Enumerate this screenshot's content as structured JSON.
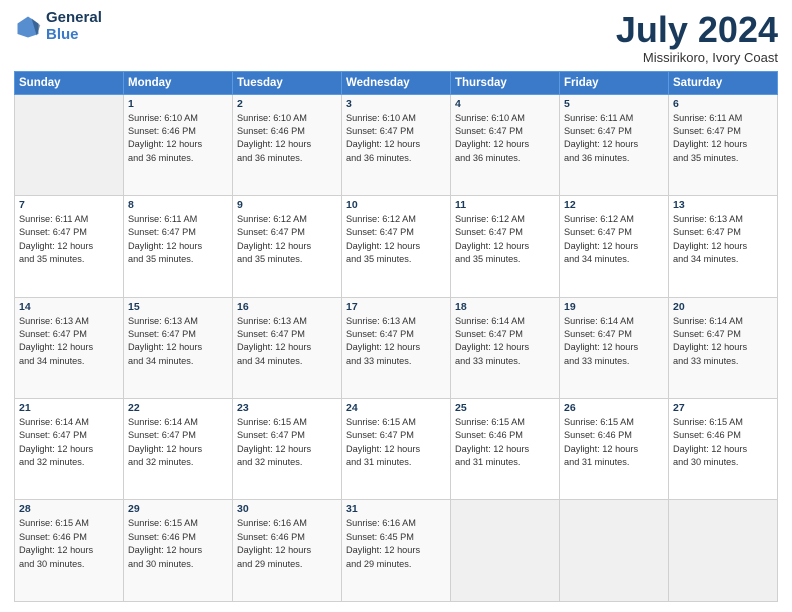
{
  "header": {
    "logo_line1": "General",
    "logo_line2": "Blue",
    "month": "July 2024",
    "location": "Missirikoro, Ivory Coast"
  },
  "days_of_week": [
    "Sunday",
    "Monday",
    "Tuesday",
    "Wednesday",
    "Thursday",
    "Friday",
    "Saturday"
  ],
  "weeks": [
    [
      {
        "day": "",
        "info": ""
      },
      {
        "day": "1",
        "info": "Sunrise: 6:10 AM\nSunset: 6:46 PM\nDaylight: 12 hours\nand 36 minutes."
      },
      {
        "day": "2",
        "info": "Sunrise: 6:10 AM\nSunset: 6:46 PM\nDaylight: 12 hours\nand 36 minutes."
      },
      {
        "day": "3",
        "info": "Sunrise: 6:10 AM\nSunset: 6:47 PM\nDaylight: 12 hours\nand 36 minutes."
      },
      {
        "day": "4",
        "info": "Sunrise: 6:10 AM\nSunset: 6:47 PM\nDaylight: 12 hours\nand 36 minutes."
      },
      {
        "day": "5",
        "info": "Sunrise: 6:11 AM\nSunset: 6:47 PM\nDaylight: 12 hours\nand 36 minutes."
      },
      {
        "day": "6",
        "info": "Sunrise: 6:11 AM\nSunset: 6:47 PM\nDaylight: 12 hours\nand 35 minutes."
      }
    ],
    [
      {
        "day": "7",
        "info": "Sunrise: 6:11 AM\nSunset: 6:47 PM\nDaylight: 12 hours\nand 35 minutes."
      },
      {
        "day": "8",
        "info": "Sunrise: 6:11 AM\nSunset: 6:47 PM\nDaylight: 12 hours\nand 35 minutes."
      },
      {
        "day": "9",
        "info": "Sunrise: 6:12 AM\nSunset: 6:47 PM\nDaylight: 12 hours\nand 35 minutes."
      },
      {
        "day": "10",
        "info": "Sunrise: 6:12 AM\nSunset: 6:47 PM\nDaylight: 12 hours\nand 35 minutes."
      },
      {
        "day": "11",
        "info": "Sunrise: 6:12 AM\nSunset: 6:47 PM\nDaylight: 12 hours\nand 35 minutes."
      },
      {
        "day": "12",
        "info": "Sunrise: 6:12 AM\nSunset: 6:47 PM\nDaylight: 12 hours\nand 34 minutes."
      },
      {
        "day": "13",
        "info": "Sunrise: 6:13 AM\nSunset: 6:47 PM\nDaylight: 12 hours\nand 34 minutes."
      }
    ],
    [
      {
        "day": "14",
        "info": "Sunrise: 6:13 AM\nSunset: 6:47 PM\nDaylight: 12 hours\nand 34 minutes."
      },
      {
        "day": "15",
        "info": "Sunrise: 6:13 AM\nSunset: 6:47 PM\nDaylight: 12 hours\nand 34 minutes."
      },
      {
        "day": "16",
        "info": "Sunrise: 6:13 AM\nSunset: 6:47 PM\nDaylight: 12 hours\nand 34 minutes."
      },
      {
        "day": "17",
        "info": "Sunrise: 6:13 AM\nSunset: 6:47 PM\nDaylight: 12 hours\nand 33 minutes."
      },
      {
        "day": "18",
        "info": "Sunrise: 6:14 AM\nSunset: 6:47 PM\nDaylight: 12 hours\nand 33 minutes."
      },
      {
        "day": "19",
        "info": "Sunrise: 6:14 AM\nSunset: 6:47 PM\nDaylight: 12 hours\nand 33 minutes."
      },
      {
        "day": "20",
        "info": "Sunrise: 6:14 AM\nSunset: 6:47 PM\nDaylight: 12 hours\nand 33 minutes."
      }
    ],
    [
      {
        "day": "21",
        "info": "Sunrise: 6:14 AM\nSunset: 6:47 PM\nDaylight: 12 hours\nand 32 minutes."
      },
      {
        "day": "22",
        "info": "Sunrise: 6:14 AM\nSunset: 6:47 PM\nDaylight: 12 hours\nand 32 minutes."
      },
      {
        "day": "23",
        "info": "Sunrise: 6:15 AM\nSunset: 6:47 PM\nDaylight: 12 hours\nand 32 minutes."
      },
      {
        "day": "24",
        "info": "Sunrise: 6:15 AM\nSunset: 6:47 PM\nDaylight: 12 hours\nand 31 minutes."
      },
      {
        "day": "25",
        "info": "Sunrise: 6:15 AM\nSunset: 6:46 PM\nDaylight: 12 hours\nand 31 minutes."
      },
      {
        "day": "26",
        "info": "Sunrise: 6:15 AM\nSunset: 6:46 PM\nDaylight: 12 hours\nand 31 minutes."
      },
      {
        "day": "27",
        "info": "Sunrise: 6:15 AM\nSunset: 6:46 PM\nDaylight: 12 hours\nand 30 minutes."
      }
    ],
    [
      {
        "day": "28",
        "info": "Sunrise: 6:15 AM\nSunset: 6:46 PM\nDaylight: 12 hours\nand 30 minutes."
      },
      {
        "day": "29",
        "info": "Sunrise: 6:15 AM\nSunset: 6:46 PM\nDaylight: 12 hours\nand 30 minutes."
      },
      {
        "day": "30",
        "info": "Sunrise: 6:16 AM\nSunset: 6:46 PM\nDaylight: 12 hours\nand 29 minutes."
      },
      {
        "day": "31",
        "info": "Sunrise: 6:16 AM\nSunset: 6:45 PM\nDaylight: 12 hours\nand 29 minutes."
      },
      {
        "day": "",
        "info": ""
      },
      {
        "day": "",
        "info": ""
      },
      {
        "day": "",
        "info": ""
      }
    ]
  ]
}
